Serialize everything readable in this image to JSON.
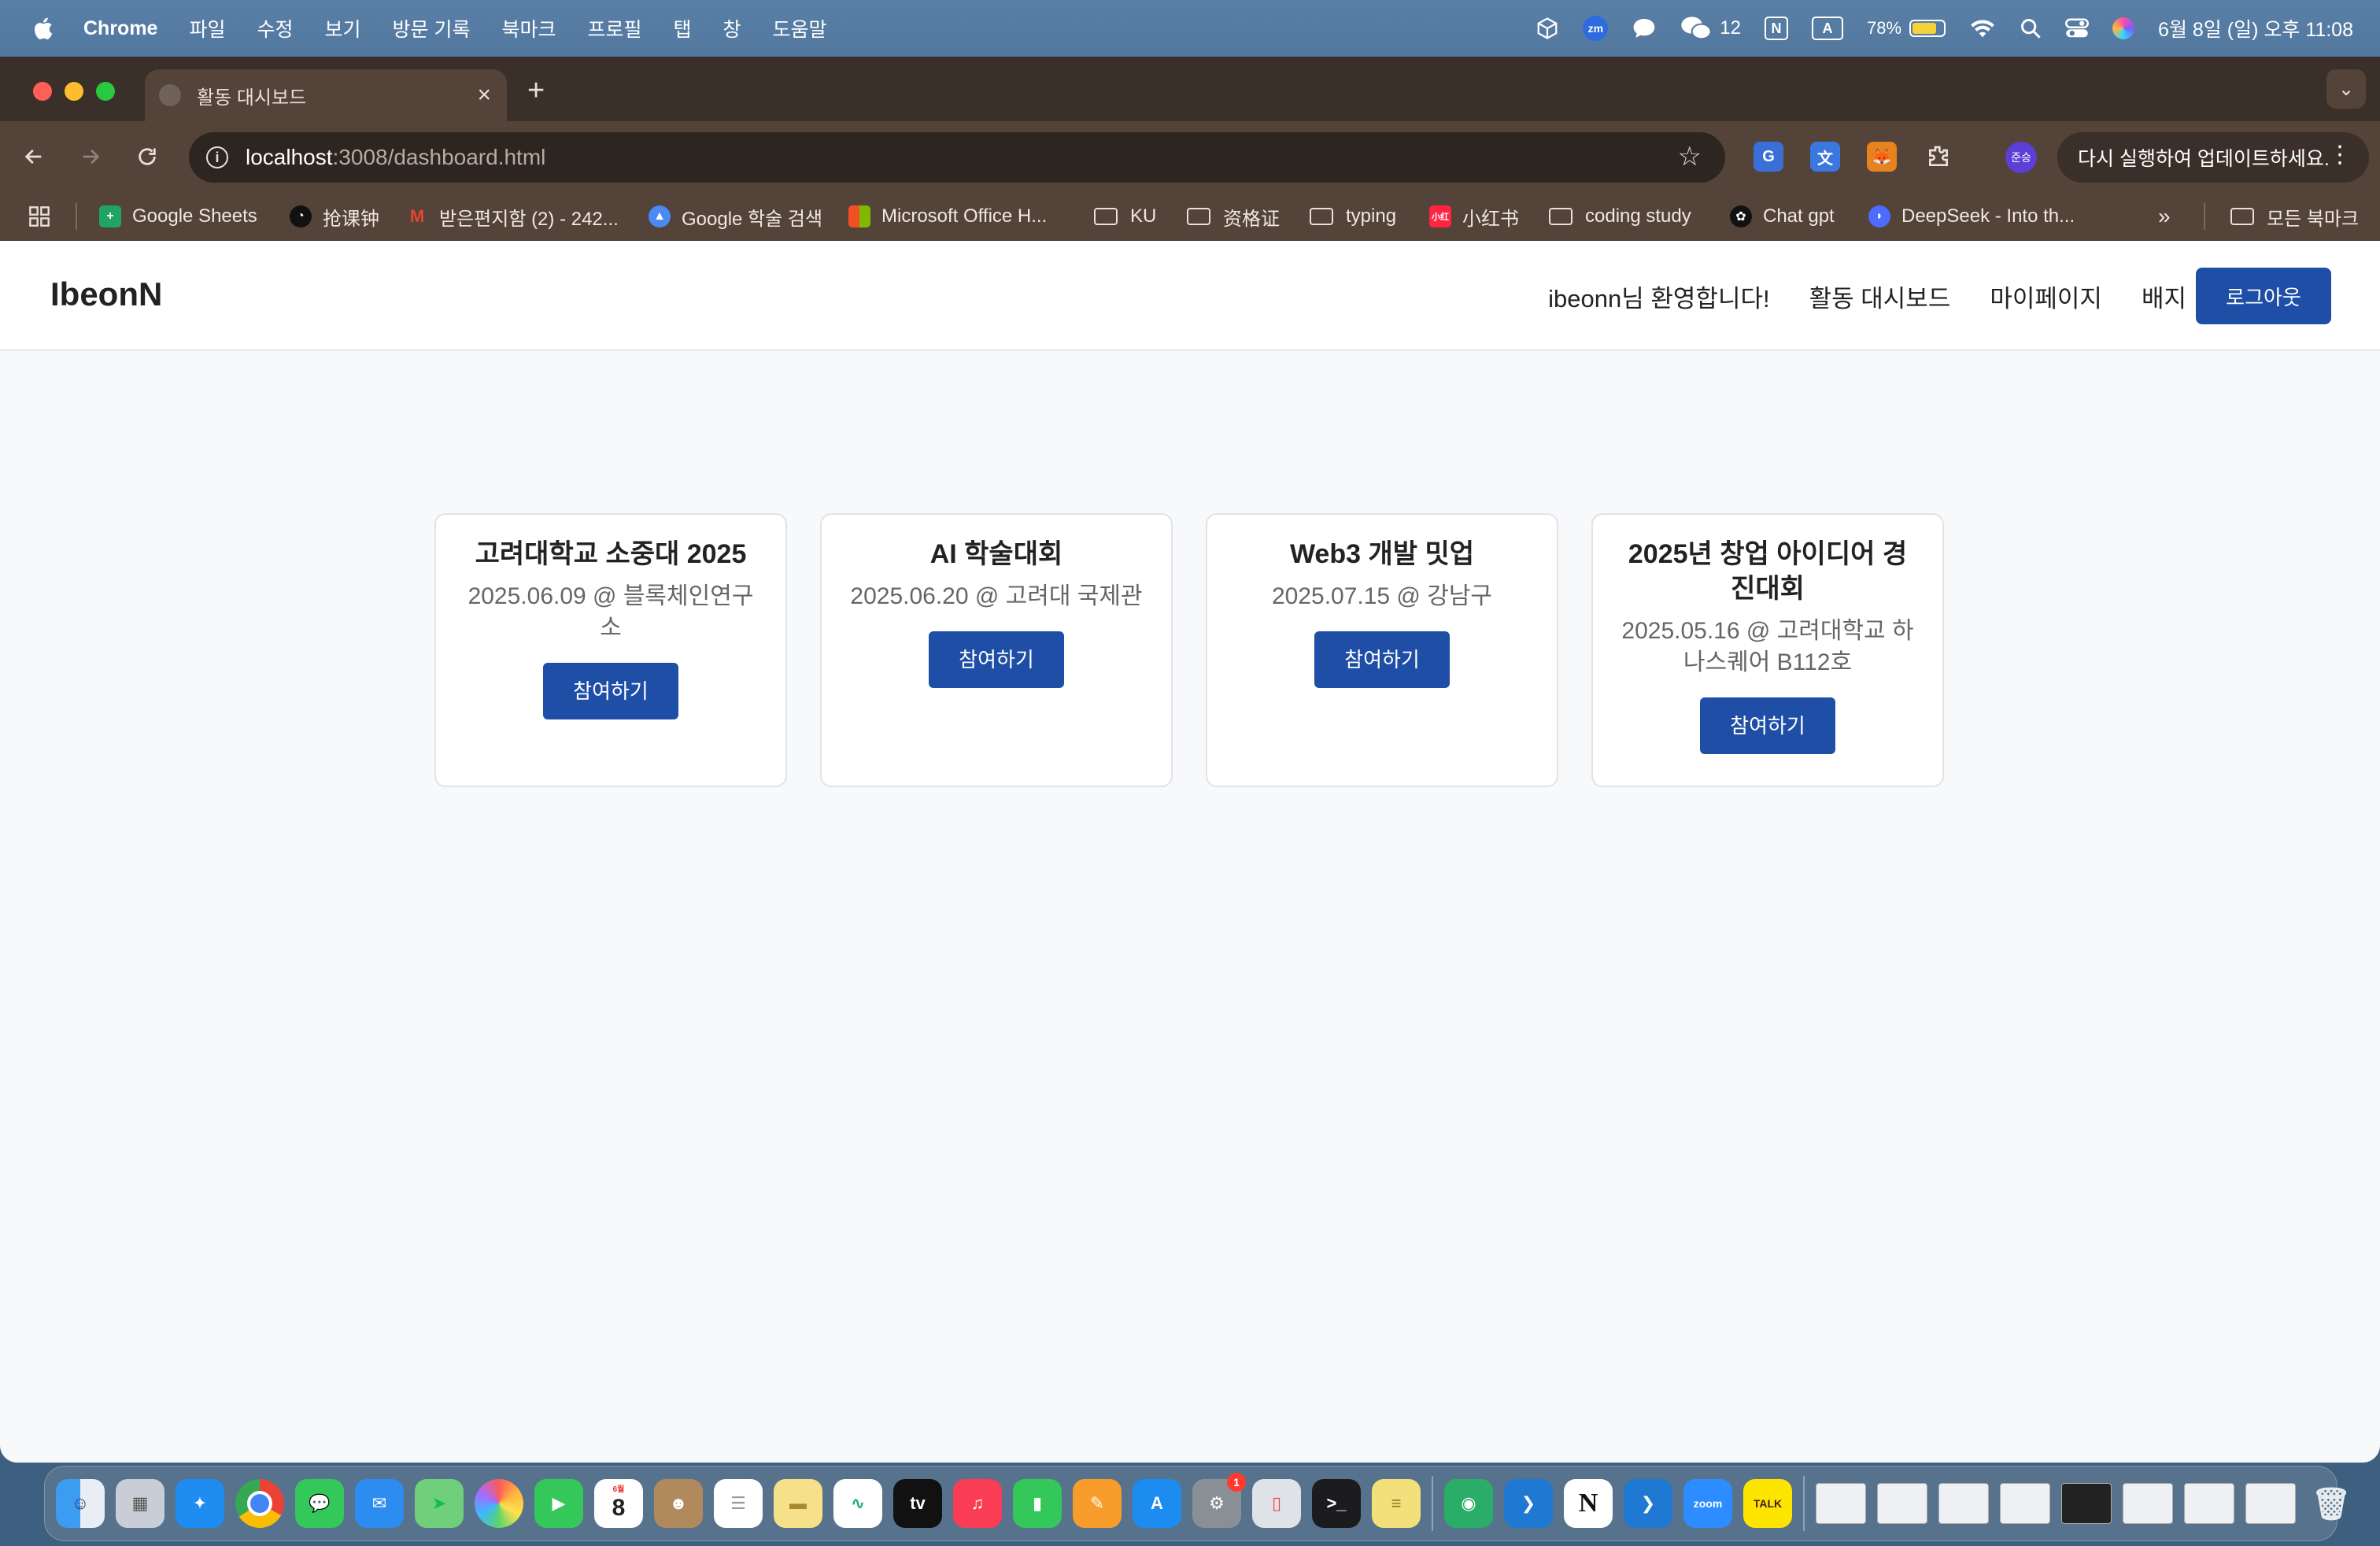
{
  "menubar": {
    "items": [
      "Chrome",
      "파일",
      "수정",
      "보기",
      "방문 기록",
      "북마크",
      "프로필",
      "탭",
      "창",
      "도움말"
    ],
    "wechat_count": "12",
    "battery": "78%",
    "battery_level": 0.78,
    "datetime": "6월 8일 (일) 오후 11:08"
  },
  "browser": {
    "tab_title": "활동 대시보드",
    "url_host": "localhost",
    "url_path": ":3008/dashboard.html",
    "update_label": "다시 실행하여 업데이트하세요.",
    "profile_initials": "준승",
    "bookmarks": [
      "Google Sheets",
      "抢课钟",
      "받은편지함 (2) - 242...",
      "Google 학술 검색",
      "Microsoft Office H...",
      "KU",
      "资格证",
      "typing",
      "小红书",
      "coding study",
      "Chat gpt",
      "DeepSeek - Into th..."
    ],
    "all_bookmarks": "모든 북마크"
  },
  "site": {
    "brand": "IbeonN",
    "welcome": "ibeonn님 환영합니다!",
    "nav": [
      "활동 대시보드",
      "마이페이지",
      "배지"
    ],
    "logout": "로그아웃",
    "accent_color": "#1f4ea6"
  },
  "events": [
    {
      "title": "고려대학교 소중대 2025",
      "meta": "2025.06.09 @ 블록체인연구소",
      "button": "참여하기"
    },
    {
      "title": "AI 학술대회",
      "meta": "2025.06.20 @ 고려대 국제관",
      "button": "참여하기"
    },
    {
      "title": "Web3 개발 밋업",
      "meta": "2025.07.15 @ 강남구",
      "button": "참여하기"
    },
    {
      "title": "2025년 창업 아이디어 경진대회",
      "meta": "2025.05.16 @ 고려대학교 하나스퀘어 B112호",
      "button": "참여하기"
    }
  ],
  "dock": {
    "calendar_day": "8",
    "settings_badge": "1"
  }
}
